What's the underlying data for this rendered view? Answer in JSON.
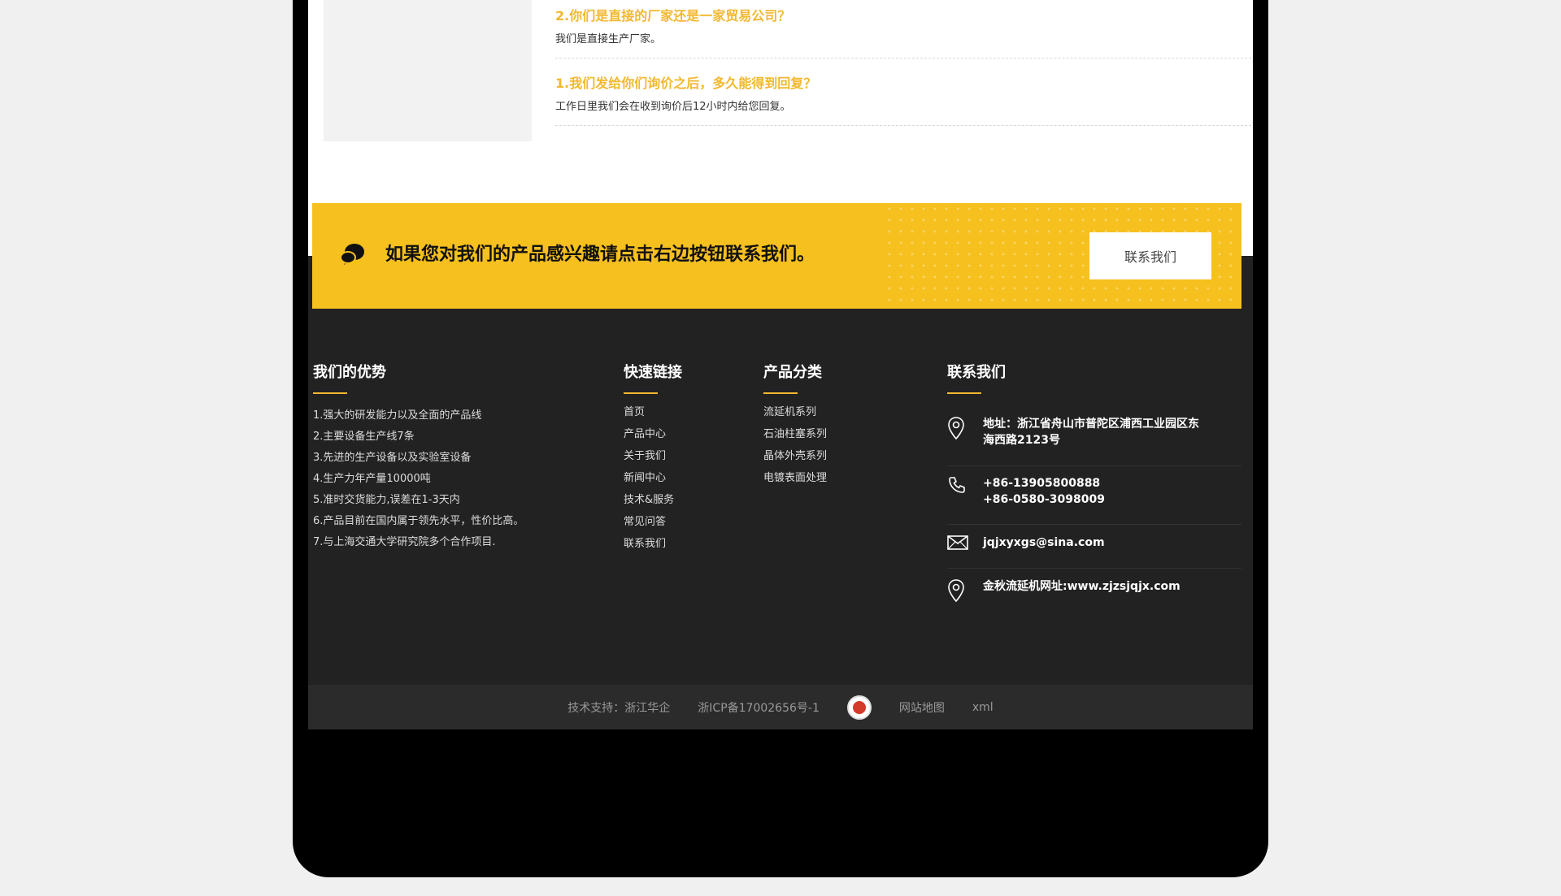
{
  "faq": [
    {
      "question": "2.你们是直接的厂家还是一家贸易公司？",
      "answer": "我们是直接生产厂家。"
    },
    {
      "question": "1.我们发给你们询价之后，多久能得到回复？",
      "answer": "工作日里我们会在收到询价后12小时内给您回复。"
    }
  ],
  "banner": {
    "text": "如果您对我们的产品感兴趣请点击右边按钮联系我们。",
    "button_label": "联系我们",
    "color": "#f6c01f"
  },
  "footer": {
    "advantages": {
      "title": "我们的优势",
      "items": [
        "1.强大的研发能力以及全面的产品线",
        "2.主要设备生产线7条",
        "3.先进的生产设备以及实验室设备",
        "4.生产力年产量10000吨",
        "5.准时交货能力,误差在1-3天内",
        "6.产品目前在国内属于领先水平，性价比高。",
        "7.与上海交通大学研究院多个合作项目."
      ]
    },
    "quick_links": {
      "title": "快速链接",
      "items": [
        "首页",
        "产品中心",
        "关于我们",
        "新闻中心",
        "技术&服务",
        "常见问答",
        "联系我们"
      ]
    },
    "categories": {
      "title": "产品分类",
      "items": [
        "流延机系列",
        "石油柱塞系列",
        "晶体外壳系列",
        "电镀表面处理"
      ]
    },
    "contact": {
      "title": "联系我们",
      "address_line1": "地址：浙江省舟山市普陀区浦西工业园区东",
      "address_line2": "海西路2123号",
      "phone1": "+86-13905800888",
      "phone2": "+86-0580-3098009",
      "email": "jqjxyxgs@sina.com",
      "website": "金秋流延机网址:www.zjzsjqjx.com"
    },
    "bottom": {
      "support": "技术支持：浙江华企",
      "icp": "浙ICP备17002656号-1",
      "sitemap": "网站地图",
      "xml": "xml"
    }
  },
  "colors": {
    "accent": "#f2b82f",
    "footer_bg": "#222222"
  },
  "icons": {
    "banner": "chat-bubble-icon",
    "address": "location-pin-icon",
    "phone": "phone-icon",
    "email": "envelope-icon",
    "website": "location-pin-icon"
  }
}
